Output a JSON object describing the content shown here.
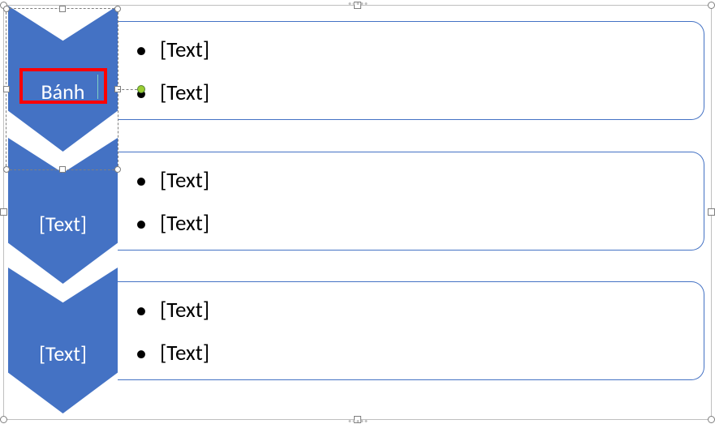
{
  "diagram": {
    "chevrons": [
      {
        "label": "Bánh",
        "selected": true
      },
      {
        "label": "[Text]",
        "selected": false
      },
      {
        "label": "[Text]",
        "selected": false
      }
    ],
    "boxes": [
      {
        "items": [
          "[Text]",
          "[Text]"
        ]
      },
      {
        "items": [
          "[Text]",
          "[Text]"
        ]
      },
      {
        "items": [
          "[Text]",
          "[Text]"
        ]
      }
    ]
  },
  "colors": {
    "accent": "#4472c4",
    "highlight": "#ff0000"
  }
}
